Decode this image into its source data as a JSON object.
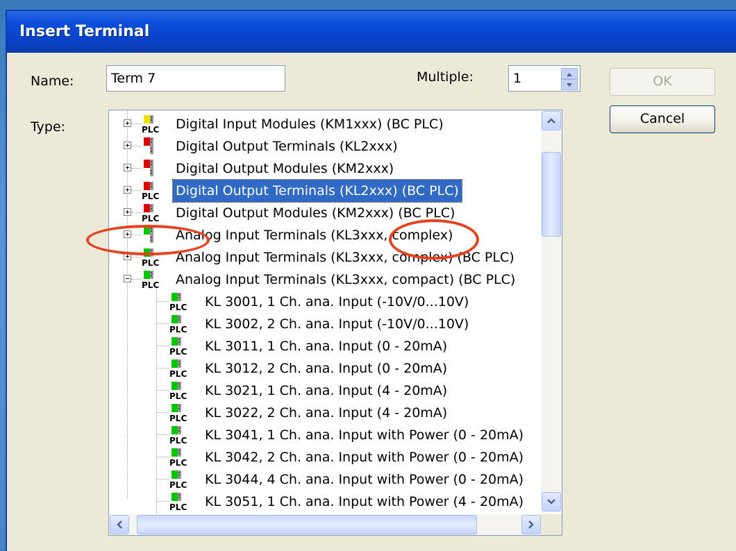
{
  "dialog": {
    "title": "Insert Terminal",
    "name_label": "Name:",
    "name_value": "Term 7",
    "multiple_label": "Multiple:",
    "multiple_value": "1",
    "type_label": "Type:",
    "ok_label": "OK",
    "cancel_label": "Cancel"
  },
  "tree": {
    "items": [
      {
        "label": "Digital Input Modules (KM1xxx) (BC PLC)",
        "level": 0,
        "expander": "plus",
        "icon": "yellow-plc",
        "selected": false
      },
      {
        "label": "Digital Output Terminals (KL2xxx)",
        "level": 0,
        "expander": "plus",
        "icon": "red",
        "selected": false
      },
      {
        "label": "Digital Output Modules (KM2xxx)",
        "level": 0,
        "expander": "plus",
        "icon": "red",
        "selected": false
      },
      {
        "label": "Digital Output Terminals (KL2xxx) (BC PLC)",
        "level": 0,
        "expander": "plus",
        "icon": "red-plc",
        "selected": true
      },
      {
        "label": "Digital Output Modules (KM2xxx) (BC PLC)",
        "level": 0,
        "expander": "plus",
        "icon": "red-plc",
        "selected": false
      },
      {
        "label": "Analog Input Terminals (KL3xxx, complex)",
        "level": 0,
        "expander": "plus",
        "icon": "green",
        "selected": false
      },
      {
        "label": "Analog Input Terminals (KL3xxx, complex) (BC PLC)",
        "level": 0,
        "expander": "plus",
        "icon": "green-plc",
        "selected": false
      },
      {
        "label": "Analog Input Terminals (KL3xxx, compact) (BC PLC)",
        "level": 0,
        "expander": "minus",
        "icon": "green-plc",
        "selected": false
      },
      {
        "label": "KL 3001, 1 Ch. ana. Input (-10V/0...10V)",
        "level": 1,
        "icon": "green-plc",
        "selected": false
      },
      {
        "label": "KL 3002, 2 Ch. ana. Input (-10V/0...10V)",
        "level": 1,
        "icon": "green-plc",
        "selected": false
      },
      {
        "label": "KL 3011, 1 Ch. ana. Input (0 - 20mA)",
        "level": 1,
        "icon": "green-plc",
        "selected": false
      },
      {
        "label": "KL 3012, 2 Ch. ana. Input (0 - 20mA)",
        "level": 1,
        "icon": "green-plc",
        "selected": false
      },
      {
        "label": "KL 3021, 1 Ch. ana. Input (4 - 20mA)",
        "level": 1,
        "icon": "green-plc",
        "selected": false
      },
      {
        "label": "KL 3022, 2 Ch. ana. Input (4 - 20mA)",
        "level": 1,
        "icon": "green-plc",
        "selected": false
      },
      {
        "label": "KL 3041, 1 Ch. ana. Input with Power (0 - 20mA)",
        "level": 1,
        "icon": "green-plc",
        "selected": false
      },
      {
        "label": "KL 3042, 2 Ch. ana. Input with Power (0 - 20mA)",
        "level": 1,
        "icon": "green-plc",
        "selected": false
      },
      {
        "label": "KL 3044, 4 Ch. ana. Input with Power (0 - 20mA)",
        "level": 1,
        "icon": "green-plc",
        "selected": false
      },
      {
        "label": "KL 3051, 1 Ch. ana. Input with Power (4 - 20mA)",
        "level": 1,
        "icon": "green-plc",
        "selected": false
      }
    ]
  },
  "colors": {
    "selection": "#316ac5",
    "annotation_oval": "#e8401c",
    "module_yellow": "#f0e000",
    "module_red": "#e00000",
    "module_green": "#00c800"
  },
  "icons": {
    "expander_plus": "plus-box-icon",
    "expander_minus": "minus-box-icon",
    "spin_up": "triangle-up-icon",
    "spin_down": "triangle-down-icon",
    "scroll_up": "chevron-up-icon",
    "scroll_down": "chevron-down-icon",
    "scroll_left": "chevron-left-icon",
    "scroll_right": "chevron-right-icon"
  }
}
